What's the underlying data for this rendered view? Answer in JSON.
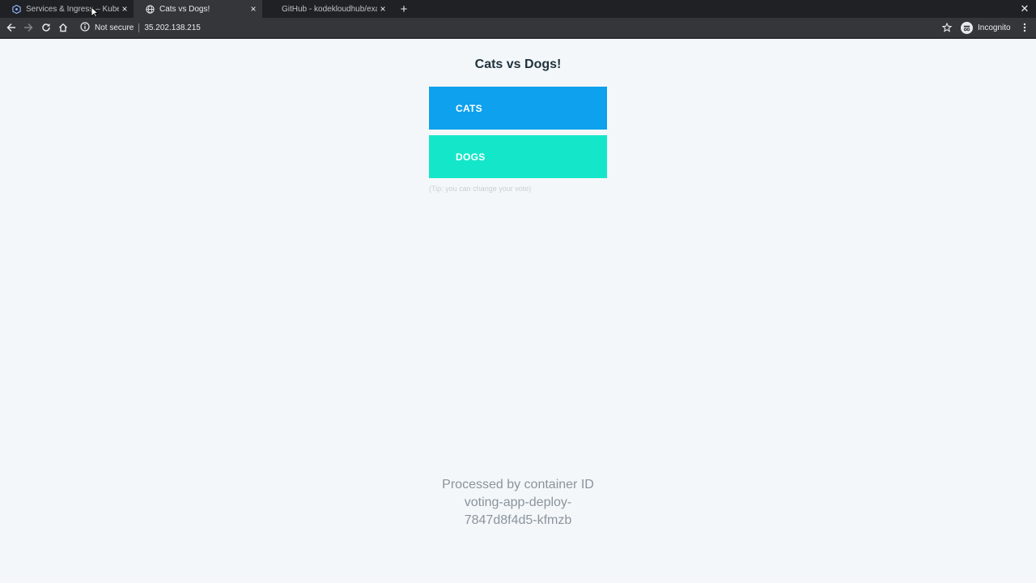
{
  "browser": {
    "tabs": [
      {
        "title": "Services & Ingress – Kubernetes",
        "icon": "kubernetes-icon",
        "active": false
      },
      {
        "title": "Cats vs Dogs!",
        "icon": "globe-icon",
        "active": true
      },
      {
        "title": "GitHub - kodekloudhub/example-voting-app",
        "icon": "github-icon",
        "active": false
      }
    ],
    "security_label": "Not secure",
    "url": "35.202.138.215",
    "profile_label": "Incognito"
  },
  "page": {
    "title": "Cats vs Dogs!",
    "options": [
      {
        "label": "CATS",
        "color": "#0ea1ed"
      },
      {
        "label": "DOGS",
        "color": "#14e7c9"
      }
    ],
    "tip": "(Tip: you can change your vote)",
    "footer": {
      "line1": "Processed by container ID",
      "line2": "voting-app-deploy-",
      "line3": "7847d8f4d5-kfmzb"
    }
  },
  "colors": {
    "chrome_dark": "#202124",
    "chrome_toolbar": "#35363a",
    "page_bg": "#f4f7fa",
    "heading": "#20323d",
    "footer_text": "#8a949c"
  }
}
